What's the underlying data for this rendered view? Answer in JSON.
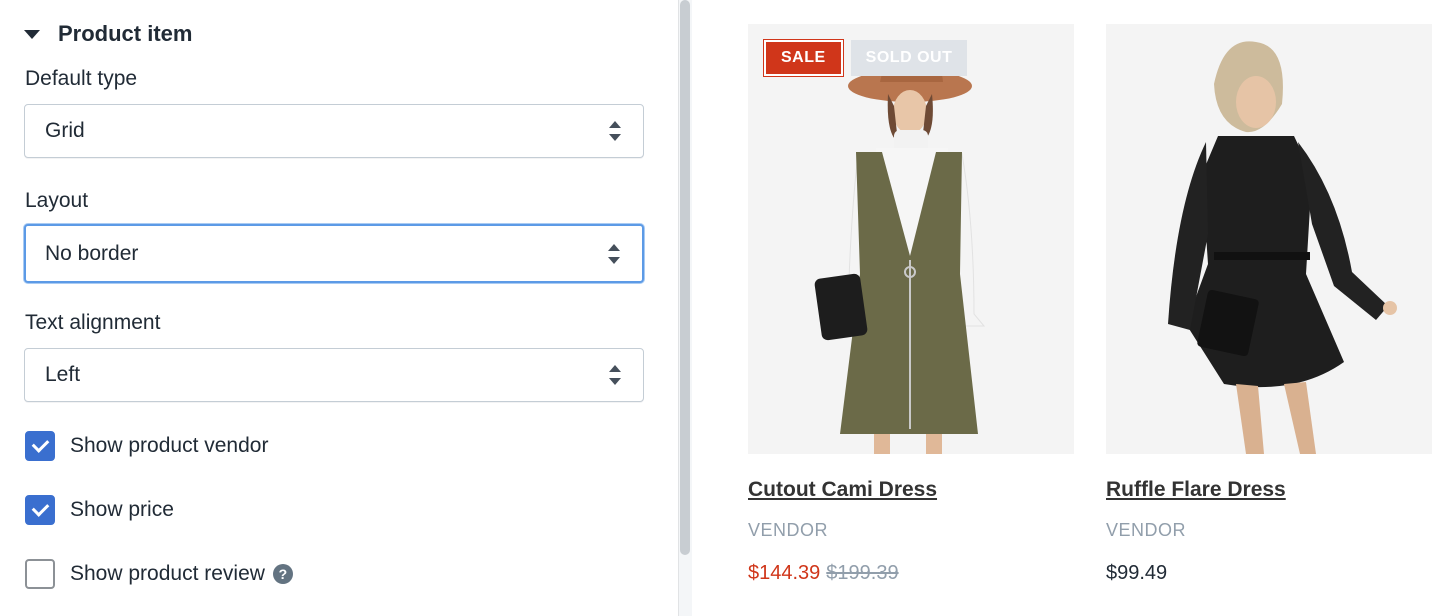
{
  "settings": {
    "section_title": "Product item",
    "default_type": {
      "label": "Default type",
      "value": "Grid"
    },
    "layout": {
      "label": "Layout",
      "value": "No border"
    },
    "text_alignment": {
      "label": "Text alignment",
      "value": "Left"
    },
    "checkboxes": [
      {
        "label": "Show product vendor",
        "checked": true
      },
      {
        "label": "Show price",
        "checked": true
      },
      {
        "label": "Show product review",
        "checked": false
      }
    ]
  },
  "products": [
    {
      "title": "Cutout Cami Dress",
      "vendor": "VENDOR",
      "price": "$144.39",
      "compare_price": "$199.39",
      "badges": {
        "sale": "SALE",
        "sold_out": "SOLD OUT"
      }
    },
    {
      "title": "Ruffle Flare Dress",
      "vendor": "VENDOR",
      "price": "$99.49"
    }
  ],
  "colors": {
    "accent": "#3a6fcf",
    "sale": "#d0361a",
    "focus": "#5c9ae6"
  }
}
